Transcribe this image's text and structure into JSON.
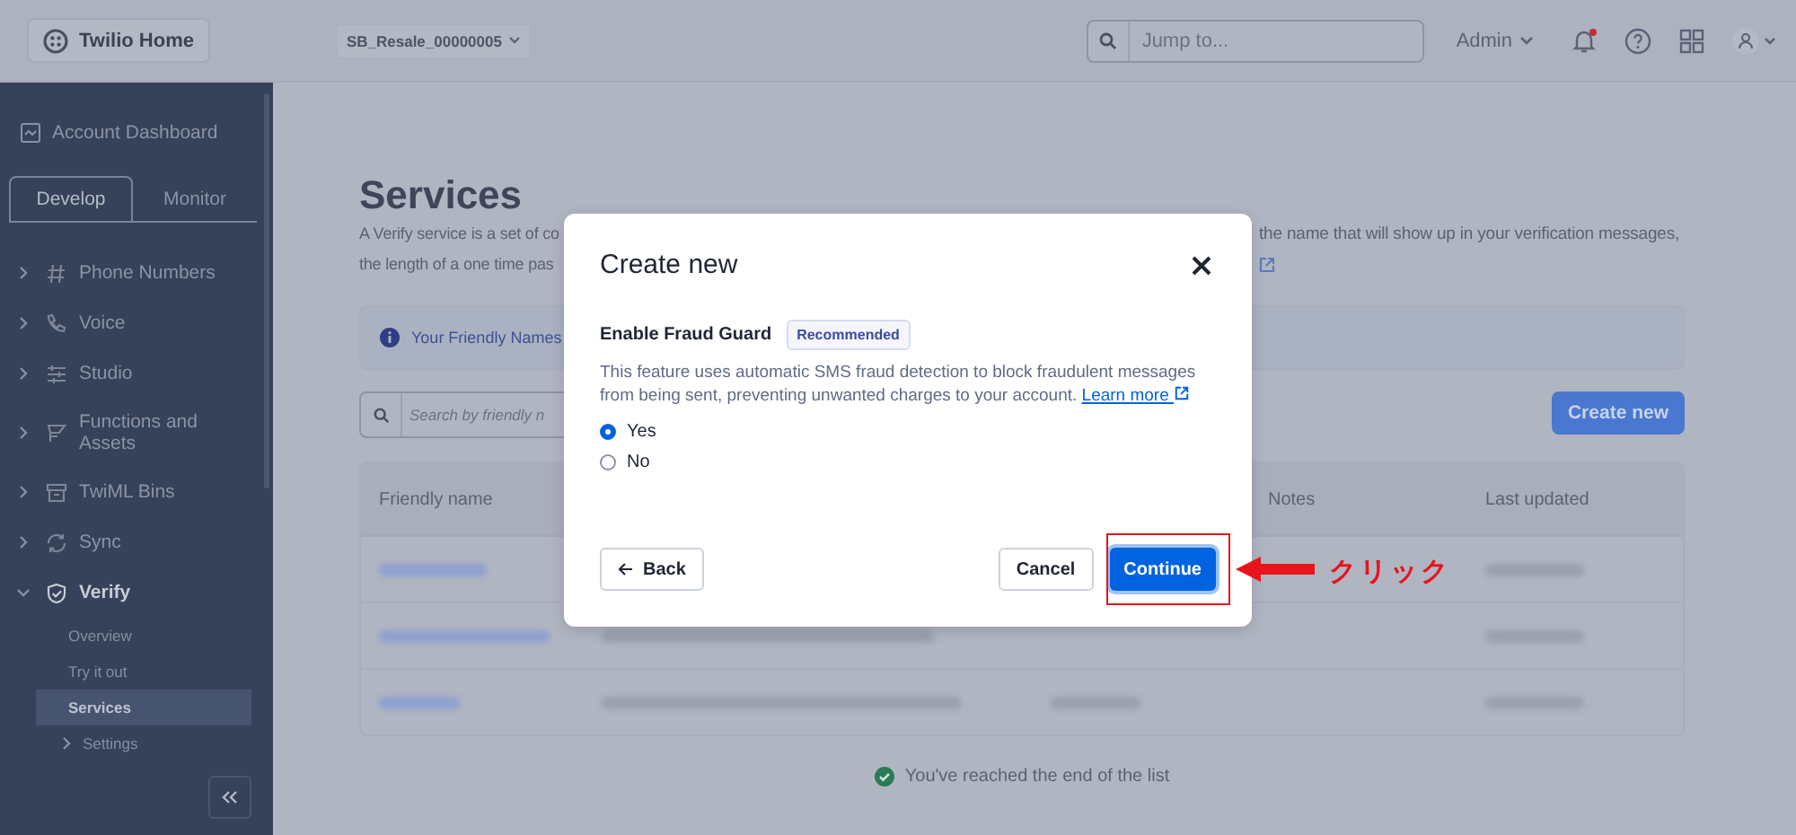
{
  "header": {
    "home": "Twilio Home",
    "account": "SB_Resale_00000005",
    "search": {
      "placeholder": "Jump to..."
    },
    "role": "Admin",
    "has_notification": true
  },
  "sidebar": {
    "dashboard": "Account Dashboard",
    "tabs": [
      {
        "label": "Develop",
        "selected": true
      },
      {
        "label": "Monitor",
        "selected": false
      }
    ],
    "items": [
      {
        "label": "Phone Numbers",
        "expanded": false
      },
      {
        "label": "Voice",
        "expanded": false
      },
      {
        "label": "Studio",
        "expanded": false
      },
      {
        "label": "Functions and Assets",
        "expanded": false
      },
      {
        "label": "TwiML Bins",
        "expanded": false
      },
      {
        "label": "Sync",
        "expanded": false
      },
      {
        "label": "Verify",
        "expanded": true,
        "children": [
          {
            "label": "Overview",
            "selected": false
          },
          {
            "label": "Try it out",
            "selected": false
          },
          {
            "label": "Services",
            "selected": true
          },
          {
            "label": "Settings",
            "selected": false,
            "expanded": false
          }
        ]
      }
    ]
  },
  "page": {
    "title": "Services",
    "description_left": [
      "A Verify service is a set of co",
      "the length of a one time pas"
    ],
    "description_right": "the name that will show up in your verification messages,",
    "banner": "Your Friendly Names",
    "search": {
      "placeholder": "Search by friendly n"
    },
    "create_button": "Create new",
    "table": {
      "columns": [
        "Friendly name",
        "Notes",
        "Last updated"
      ]
    },
    "end_message": "You've reached the end of the list"
  },
  "modal": {
    "title": "Create new",
    "field_label": "Enable Fraud Guard",
    "badge": "Recommended",
    "description": "This feature uses automatic SMS fraud detection to block fraudulent messages from being sent, preventing unwanted charges to your account.",
    "link": "Learn more",
    "options": [
      {
        "label": "Yes",
        "selected": true
      },
      {
        "label": "No",
        "selected": false
      }
    ],
    "back": "Back",
    "cancel": "Cancel",
    "continue": "Continue"
  },
  "annotation": {
    "label": "クリック"
  }
}
